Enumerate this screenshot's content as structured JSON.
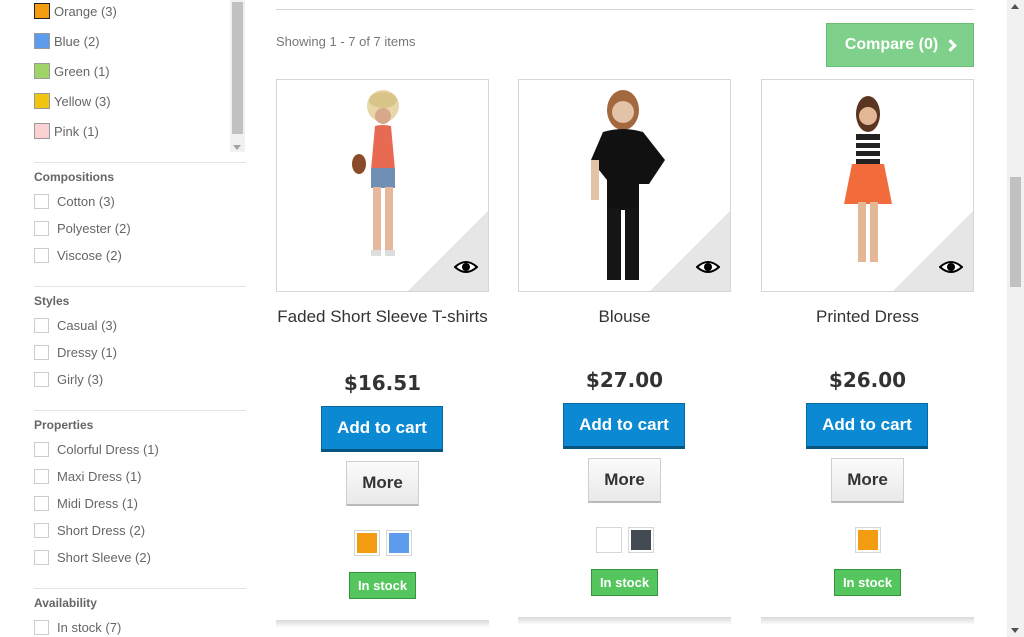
{
  "filters": {
    "colors": [
      {
        "label": "Orange (3)",
        "color": "#f39c11"
      },
      {
        "label": "Blue (2)",
        "color": "#5d9cec"
      },
      {
        "label": "Green (1)",
        "color": "#a0d468"
      },
      {
        "label": "Yellow (3)",
        "color": "#f1c40f"
      },
      {
        "label": "Pink (1)",
        "color": "#fcd1d4"
      }
    ],
    "compositions": {
      "title": "Compositions",
      "items": [
        "Cotton (3)",
        "Polyester (2)",
        "Viscose (2)"
      ]
    },
    "styles": {
      "title": "Styles",
      "items": [
        "Casual (3)",
        "Dressy (1)",
        "Girly (3)"
      ]
    },
    "properties": {
      "title": "Properties",
      "items": [
        "Colorful Dress (1)",
        "Maxi Dress (1)",
        "Midi Dress (1)",
        "Short Dress (2)",
        "Short Sleeve (2)"
      ]
    },
    "availability": {
      "title": "Availability",
      "items": [
        "In stock (7)"
      ]
    }
  },
  "listing": {
    "showing": "Showing 1 - 7 of 7 items",
    "compare_label": "Compare (0)",
    "compare_color": "#7fd08a"
  },
  "products": [
    {
      "name": "Faded Short Sleeve T-shirts",
      "price": "$16.51",
      "add_label": "Add to cart",
      "more_label": "More",
      "stock": "In stock",
      "colors": [
        "#f39c11",
        "#5d9cec"
      ]
    },
    {
      "name": "Blouse",
      "price": "$27.00",
      "add_label": "Add to cart",
      "more_label": "More",
      "stock": "In stock",
      "colors": [
        "#ffffff",
        "#434a54"
      ]
    },
    {
      "name": "Printed Dress",
      "price": "$26.00",
      "add_label": "Add to cart",
      "more_label": "More",
      "stock": "In stock",
      "colors": [
        "#f39c11"
      ]
    }
  ]
}
